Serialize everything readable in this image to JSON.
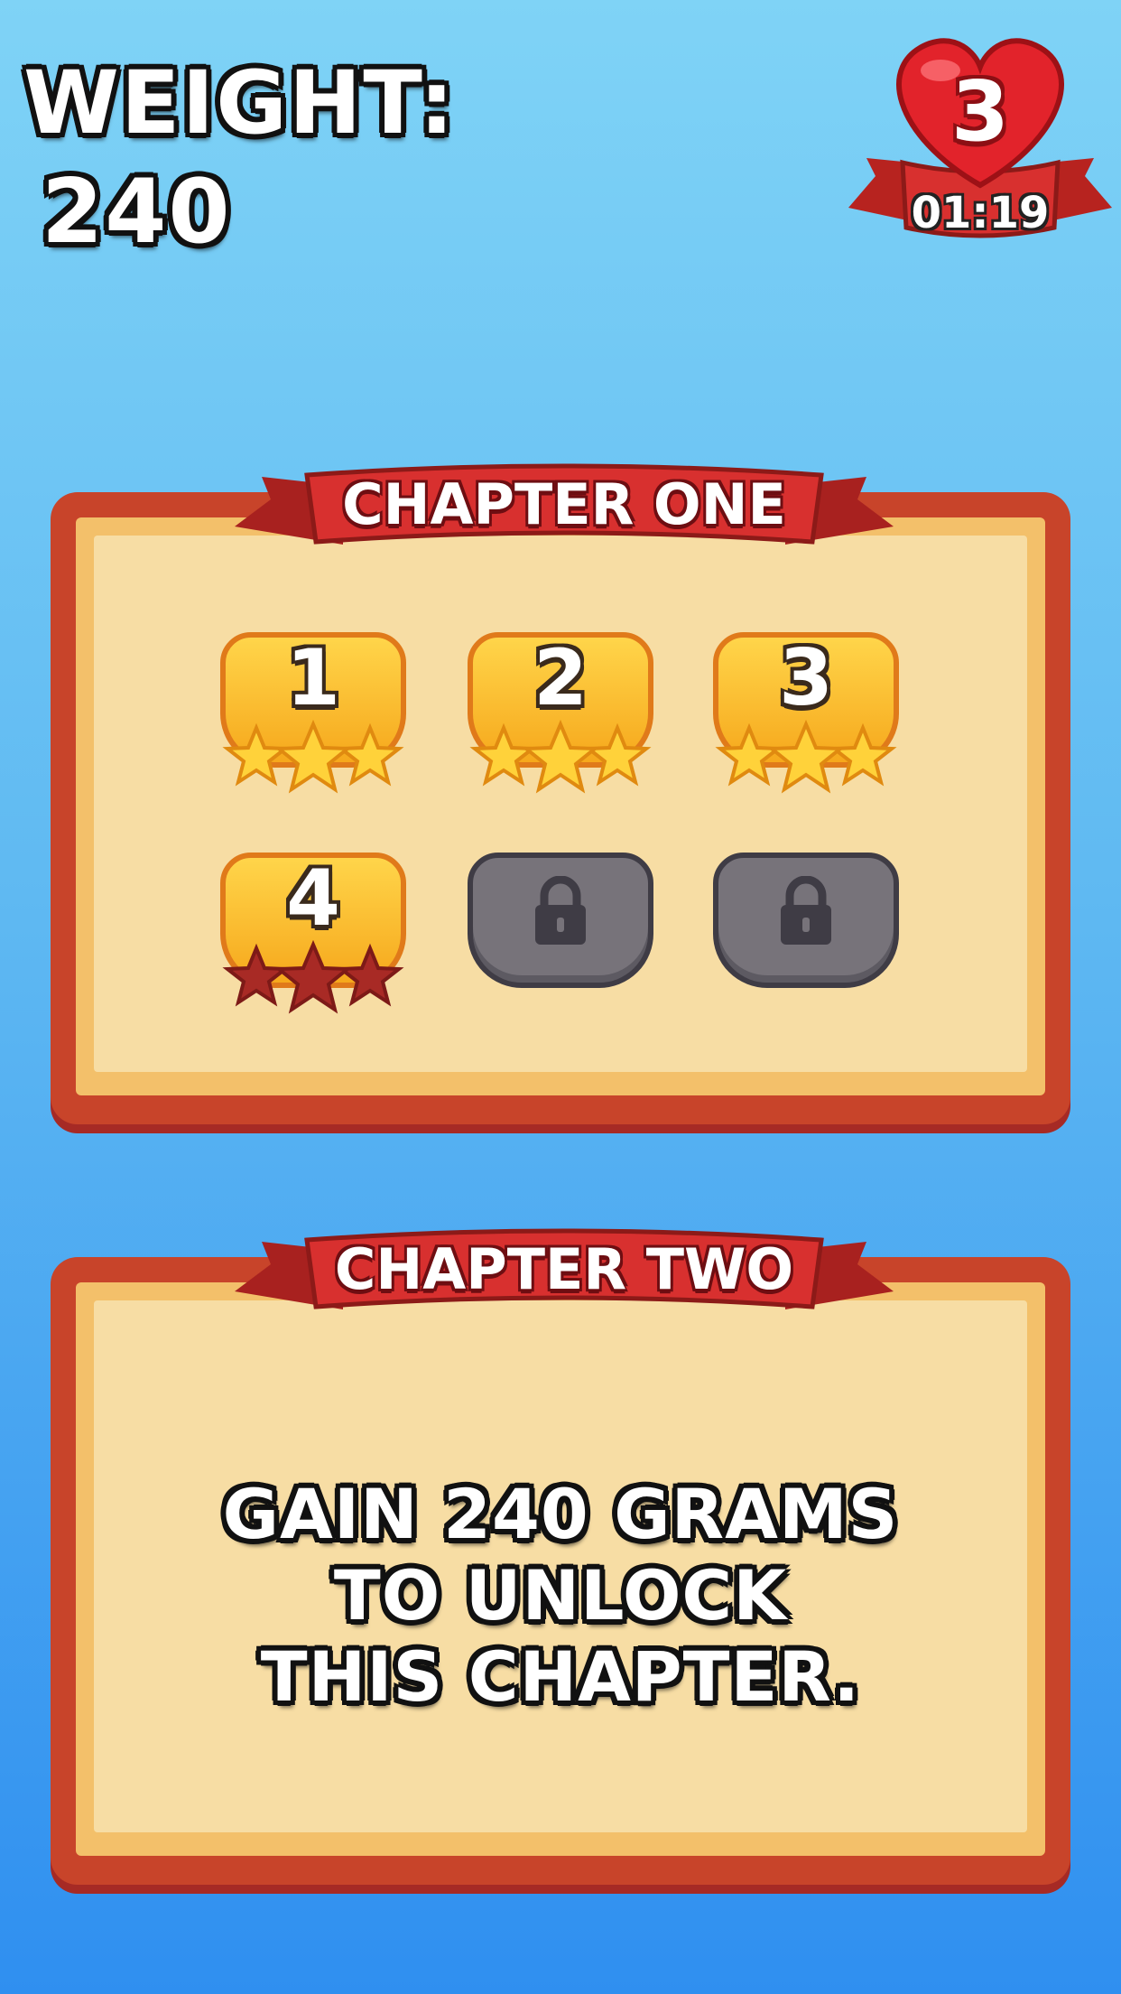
{
  "hud": {
    "weight_label": "WEIGHT:",
    "weight_value": "240",
    "lives_count": "3",
    "lives_timer": "01:19"
  },
  "chapter_one": {
    "title": "CHAPTER ONE",
    "levels": [
      {
        "label": "1",
        "state": "unlocked",
        "stars_earned": 3
      },
      {
        "label": "2",
        "state": "unlocked",
        "stars_earned": 3
      },
      {
        "label": "3",
        "state": "unlocked",
        "stars_earned": 3
      },
      {
        "label": "4",
        "state": "unlocked",
        "stars_earned": 0
      },
      {
        "label": "",
        "state": "locked",
        "icon": "lock-icon"
      },
      {
        "label": "",
        "state": "locked",
        "icon": "lock-icon"
      }
    ]
  },
  "chapter_two": {
    "title": "CHAPTER TWO",
    "locked_message": "GAIN 240 GRAMS\nTO UNLOCK\nTHIS CHAPTER."
  },
  "colors": {
    "panel_border": "#c8442a",
    "paper": "#f7dda4",
    "ribbon": "#d8302f",
    "star_gold": "#ffd23a",
    "star_empty": "#a82a25",
    "locked_tile": "#77737a"
  }
}
